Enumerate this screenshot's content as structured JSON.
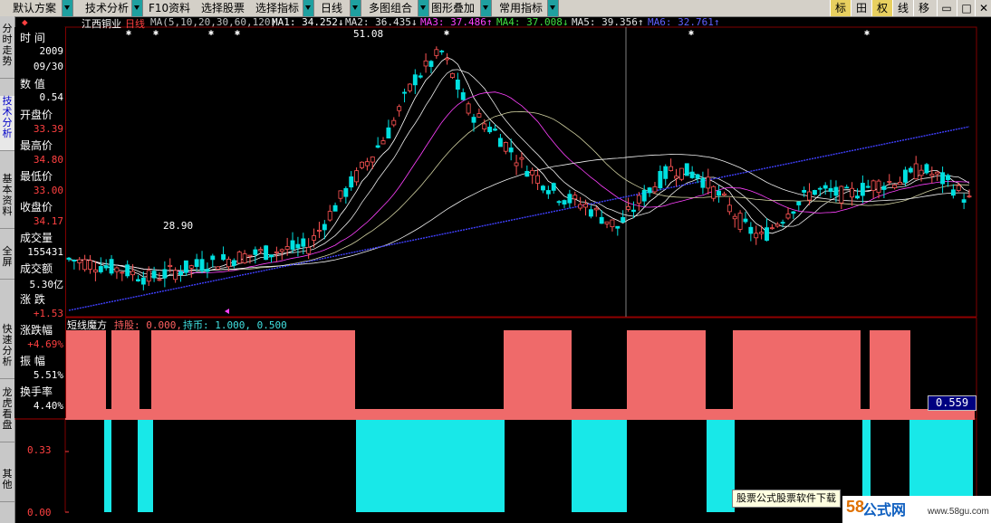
{
  "toolbar": {
    "items": [
      "默认方案",
      "技术分析",
      "F10资料",
      "选择股票",
      "选择指标",
      "日线",
      "多图组合",
      "图形叠加",
      "常用指标"
    ],
    "right": [
      "标",
      "田",
      "权",
      "线",
      "移"
    ]
  },
  "sidetabs": [
    "分时走势",
    "技术分析",
    "基本资料",
    "全屏",
    "快速分析",
    "龙虎看盘",
    "其他"
  ],
  "chart_header": {
    "stock": "江西铜业",
    "period": "日线",
    "ma_def": "MA(5,10,20,30,60,120)",
    "ma1": "MA1: 34.252↓",
    "ma2": "MA2: 36.435↓",
    "ma3": "MA3: 37.486↑",
    "ma4": "MA4: 37.008↓",
    "ma5": "MA5: 39.356↑",
    "ma6": "MA6: 32.761↑"
  },
  "info": {
    "time_label": "时  间",
    "year": "2009",
    "date": "09/30",
    "value_label": "数  值",
    "value": "0.54",
    "open_label": "开盘价",
    "open": "33.39",
    "high_label": "最高价",
    "high": "34.80",
    "low_label": "最低价",
    "low": "33.00",
    "close_label": "收盘价",
    "close": "34.17",
    "vol_label": "成交量",
    "vol": "155431",
    "amount_label": "成交额",
    "amount": "5.30亿",
    "change_label": "涨  跌",
    "change": "+1.53",
    "pct_label": "涨跌幅",
    "pct": "+4.69%",
    "amp_label": "振  幅",
    "amp": "5.51%",
    "turn_label": "换手率",
    "turn": "4.40%"
  },
  "annotations": {
    "high": "51.08",
    "low": "28.90"
  },
  "indicator": {
    "name": "短线魔方",
    "hold": "持股: 0.000,",
    "coin": "持币: 1.000, 0.500",
    "badge": "0.559",
    "y_labels": [
      "0.33",
      "0.00"
    ]
  },
  "watermark": "股票公式股票软件下载",
  "site": {
    "a": "58",
    "b": "公式网",
    "c": "www.58gu.com"
  },
  "colors": {
    "up": "#ff5454",
    "down": "#00e0e0",
    "hold": "#ef6a6a",
    "coin": "#18e8e8",
    "ma1": "#ffffff",
    "ma3": "#ff40ff",
    "ma6": "#4040ff"
  }
}
